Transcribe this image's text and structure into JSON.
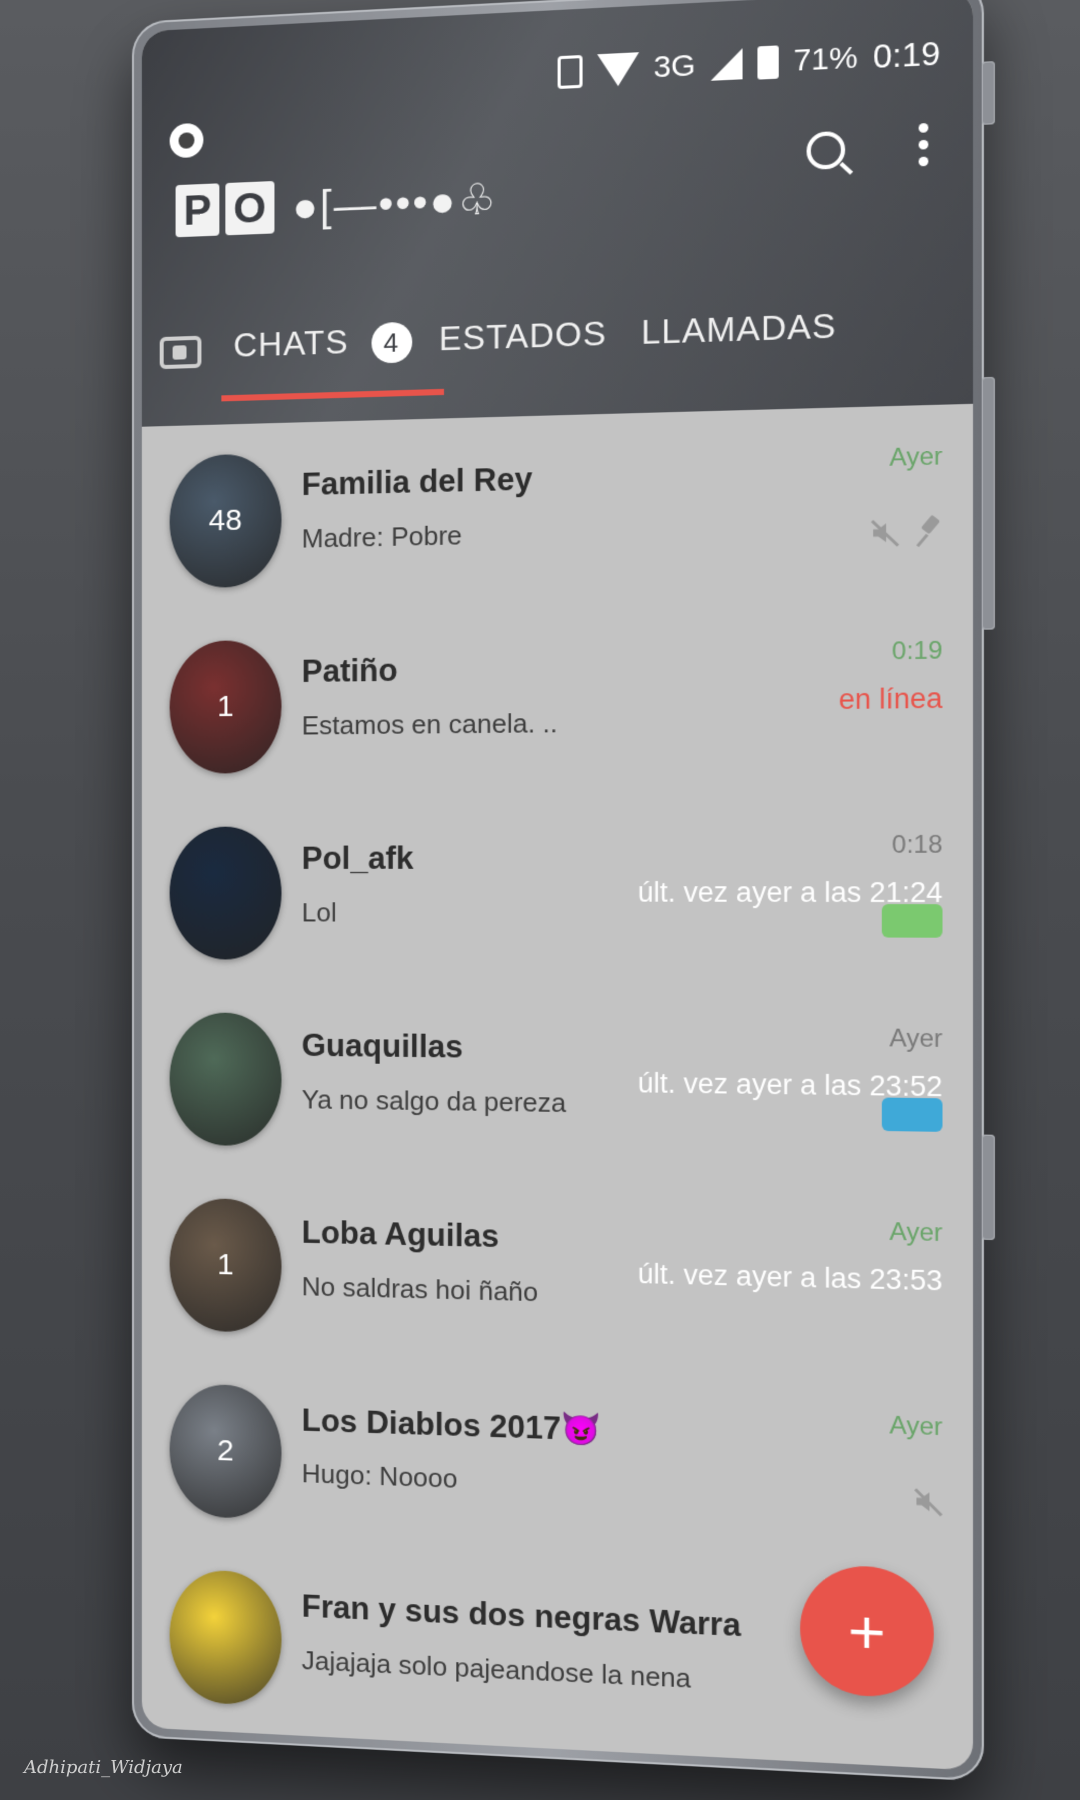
{
  "status_bar": {
    "network": "3G",
    "battery": "71%",
    "time": "0:19"
  },
  "header": {
    "title_block": [
      "P",
      "O"
    ],
    "title_rest": "●[—•••●♧"
  },
  "tabs": [
    {
      "label": "CHATS",
      "badge": "4"
    },
    {
      "label": "ESTADOS"
    },
    {
      "label": "LLAMADAS"
    }
  ],
  "chats": [
    {
      "name": "Familia del Rey",
      "preview": "Madre: Pobre",
      "time": "Ayer",
      "time_color": "#6aa56a",
      "sub": "",
      "sub_color": "",
      "avatar_count": "48",
      "avatar_color": "#4a5a6a",
      "icons": [
        "mute",
        "pin"
      ]
    },
    {
      "name": "Patiño",
      "preview": "Estamos en canela. ..",
      "time": "0:19",
      "time_color": "#6aa56a",
      "sub": "en línea",
      "sub_color": "#e8544b",
      "avatar_count": "1",
      "avatar_color": "#7a3030",
      "icons": []
    },
    {
      "name": "Pol_afk",
      "preview": "Lol",
      "time": "0:18",
      "time_color": "#7a7a7a",
      "sub": "últ. vez ayer a las 21:24",
      "sub_color": "#ffffff",
      "avatar_count": "",
      "avatar_color": "#1a2a40",
      "icons": [
        "toggle-green"
      ]
    },
    {
      "name": "Guaquillas",
      "preview": "Ya no salgo da pereza",
      "time": "Ayer",
      "time_color": "#7a7a7a",
      "sub": "últ. vez ayer a las 23:52",
      "sub_color": "#ffffff",
      "avatar_count": "",
      "avatar_color": "#4f6a58",
      "icons": [
        "toggle-blue"
      ]
    },
    {
      "name": "Loba Aguilas",
      "preview": "No saldras hoi ñaño",
      "time": "Ayer",
      "time_color": "#6aa56a",
      "sub": "últ. vez ayer a las 23:53",
      "sub_color": "#ffffff",
      "avatar_count": "1",
      "avatar_color": "#6a5a4a",
      "icons": []
    },
    {
      "name": "Los Diablos 2017😈",
      "preview": "Hugo: Noooo",
      "time": "Ayer",
      "time_color": "#6aa56a",
      "sub": "",
      "sub_color": "",
      "avatar_count": "2",
      "avatar_color": "#7a8088",
      "icons": [
        "mute"
      ]
    },
    {
      "name": "Fran y sus  dos  negras Warra",
      "preview": "Jajajaja solo pajeandose la nena",
      "time": "",
      "time_color": "",
      "sub": "",
      "sub_color": "",
      "avatar_count": "",
      "avatar_color": "#f3d23a",
      "icons": []
    }
  ],
  "fab": {
    "label": "+"
  },
  "signature": "Adhipati_Widjaya",
  "colors": {
    "accent": "#e8544b",
    "header": "#45474c",
    "list_bg": "#c3c3c3"
  }
}
